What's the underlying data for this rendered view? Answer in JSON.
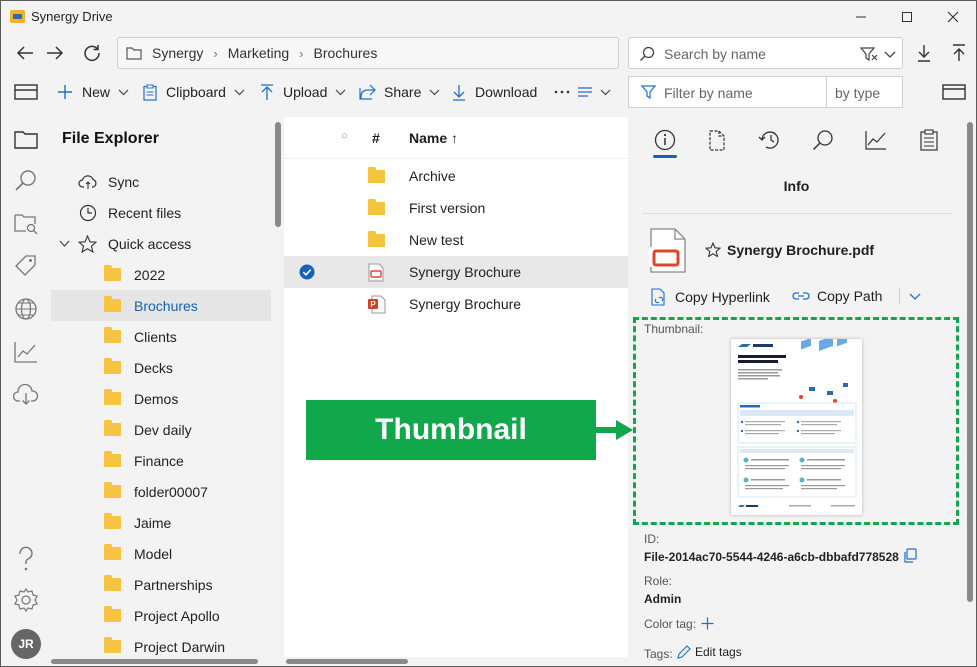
{
  "window": {
    "title": "Synergy Drive"
  },
  "breadcrumb": [
    "Synergy",
    "Marketing",
    "Brochures"
  ],
  "search": {
    "placeholder": "Search by name"
  },
  "toolbar": {
    "new_label": "New",
    "clipboard_label": "Clipboard",
    "upload_label": "Upload",
    "share_label": "Share",
    "download_label": "Download"
  },
  "filter": {
    "placeholder": "Filter by name",
    "type_label": "by type"
  },
  "sidebar": {
    "header": "File Explorer",
    "items": [
      {
        "label": "Sync",
        "icon": "cloud-sync-icon"
      },
      {
        "label": "Recent files",
        "icon": "clock-icon"
      },
      {
        "label": "Quick access",
        "icon": "star-icon"
      }
    ],
    "folders": [
      "2022",
      "Brochures",
      "Clients",
      "Decks",
      "Demos",
      "Dev daily",
      "Finance",
      "folder00007",
      "Jaime",
      "Model",
      "Partnerships",
      "Project Apollo",
      "Project Darwin"
    ],
    "selected": "Brochures"
  },
  "list": {
    "columns": {
      "index": "#",
      "name": "Name ↑"
    },
    "rows": [
      {
        "name": "Archive",
        "type": "folder"
      },
      {
        "name": "First version",
        "type": "folder"
      },
      {
        "name": "New test",
        "type": "folder"
      },
      {
        "name": "Synergy Brochure",
        "type": "pdf",
        "selected": true
      },
      {
        "name": "Synergy Brochure",
        "type": "pptx"
      }
    ]
  },
  "panel": {
    "title": "Info",
    "file_name": "Synergy Brochure.pdf",
    "copy_hyperlink": "Copy Hyperlink",
    "copy_path": "Copy Path",
    "thumbnail_label": "Thumbnail:",
    "id_label": "ID:",
    "id_value": "File-2014ac70-5544-4246-a6cb-dbbafd778528",
    "role_label": "Role:",
    "role_value": "Admin",
    "color_tag_label": "Color tag:",
    "tags_label": "Tags:",
    "edit_tags": "Edit tags"
  },
  "avatar": "JR",
  "annotation": {
    "label": "Thumbnail",
    "color": "#11a84c"
  },
  "accent": "#1463b8"
}
